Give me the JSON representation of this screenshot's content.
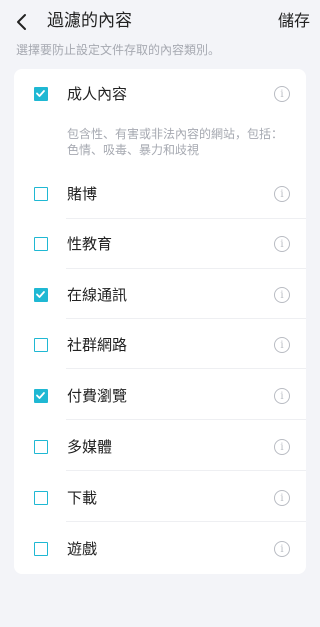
{
  "header": {
    "title": "過濾的內容",
    "save_label": "儲存"
  },
  "subtitle": "選擇要防止設定文件存取的內容類別。",
  "categories": [
    {
      "label": "成人內容",
      "checked": true
    },
    {
      "label": "賭博",
      "checked": false
    },
    {
      "label": "性教育",
      "checked": false
    },
    {
      "label": "在線通訊",
      "checked": true
    },
    {
      "label": "社群網路",
      "checked": false
    },
    {
      "label": "付費瀏覽",
      "checked": true
    },
    {
      "label": "多媒體",
      "checked": false
    },
    {
      "label": "下載",
      "checked": false
    },
    {
      "label": "遊戲",
      "checked": false
    }
  ],
  "adult_description": "包含性、有害或非法內容的網站，包括：色情、吸毒、暴力和歧視",
  "info_glyph": "i",
  "colors": {
    "accent": "#1fb8d3"
  }
}
